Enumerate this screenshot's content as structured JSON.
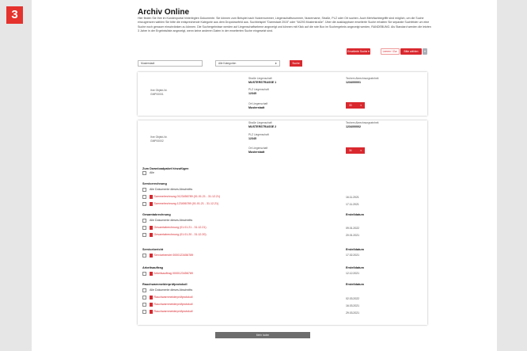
{
  "step_badge": "3",
  "title": "Archiv Online",
  "intro": "Hier finden Sie Ihre im Kundenportal hinterlegten Dokumente. Sie können zum Beispiel nach Nutzernummer, Liegenschaftsnummer, Nutzername, Straße, PLZ oder Ort suchen. Auch Mehrfachbegriffe sind möglich, um die Suche einzugrenzen wählen Sie bitte die entsprechende Kategorie aus dem Dropdownfeld aus. Suchbeispiel \"Darmstadt 2015\" oder \"64293 Musterstraße\". Über die ausklappbare erweiterte Suche erhalten Sie separate Suchfelder um eine Suche noch genauer einschränken zu können. Die Suchergebnisse werden auf Liegenschaftsebene angezeigt und können mit Klick auf die rote Box im Suchergebnis angezeigt werden, RANDEBUNG. Als Standard werden die letzten 3 Jahre in der Ergebnisliste angezeigt, wenn keine anderen Daten in der erweiterten Suche eingesetzt sind.",
  "toolbar": {
    "advanced": "Erweiterte Suche ▾",
    "reset": "Leeren / Zur.",
    "select": "Bitte wählen",
    "grey": "▾"
  },
  "search": {
    "value": "Musterstadt",
    "category": "Alle Kategorien",
    "category_arrow": "⬍",
    "button": "Suche"
  },
  "properties": [
    {
      "obj_label": "Ihre Objekt-Nr.",
      "obj_value": "GMP00001",
      "street_label": "Straße Liegenschaft",
      "street": "MUSTERSTRASSE 1",
      "plz_label": "PLZ Liegenschaft",
      "plz": "12345",
      "city_label": "Ort Liegenschaft",
      "city": "Musterstadt",
      "unit_label": "Techem Abrechnungseinheit",
      "unit": "1234/00001",
      "pill": "33",
      "pill_arrow": "▾"
    },
    {
      "obj_label": "Ihre Objekt-Nr.",
      "obj_value": "GMP00002",
      "street_label": "Straße Liegenschaft",
      "street": "MUSTERSTRASSE 2",
      "plz_label": "PLZ Liegenschaft",
      "plz": "12345",
      "city_label": "Ort Liegenschaft",
      "city": "Musterstadt",
      "unit_label": "Techem Abrechnungseinheit",
      "unit": "1234/00002",
      "pill": "34",
      "pill_arrow": "▾"
    }
  ],
  "download": {
    "label": "Zum Downloadpaket hinzufügen",
    "all": "Alle"
  },
  "date_label": "Erstelldatum",
  "all_docs": "Alle Dokumente dieses Abschnitts",
  "sections": {
    "service": {
      "title": "Servicerechnung",
      "items": [
        {
          "name": "Sammelrechnung 0123456789 (01.01.21 - 31.12.21)",
          "date": "16.11.2021"
        },
        {
          "name": "Sammelrechnung 123456789 (01.01.21 - 31.12.21)",
          "date": "17.11.2021"
        }
      ]
    },
    "gesamt": {
      "title": "Gesamtabrechnung",
      "items": [
        {
          "name": "Gesamtabrechnung (01.01.21 - 31.12.21)",
          "date": "09.01.2022"
        },
        {
          "name": "Gesamtabrechnung (01.01.20 - 31.12.20)",
          "date": "20.01.2021"
        }
      ]
    },
    "bericht": {
      "title": "Servicebericht",
      "items": [
        {
          "name": "Servicebericht 0000123456789",
          "date": "17.02.2021"
        }
      ]
    },
    "auftrag": {
      "title": "Arbeitsauftrag",
      "items": [
        {
          "name": "Arbeitsauftrag 0000123456789",
          "date": "12.12.2021"
        }
      ]
    },
    "rauch": {
      "title": "Rauchwarnmelderprüfprotokoll",
      "items": [
        {
          "name": "Rauchwarnmelderprüfprotokoll",
          "date": "02.03.2022"
        },
        {
          "name": "Rauchwarnmelderprüfprotokoll",
          "date": "16.03.2021"
        },
        {
          "name": "Rauchwarnmelderprüfprotokoll",
          "date": "29.03.2021"
        }
      ]
    }
  },
  "more_button": "Mehr laden"
}
